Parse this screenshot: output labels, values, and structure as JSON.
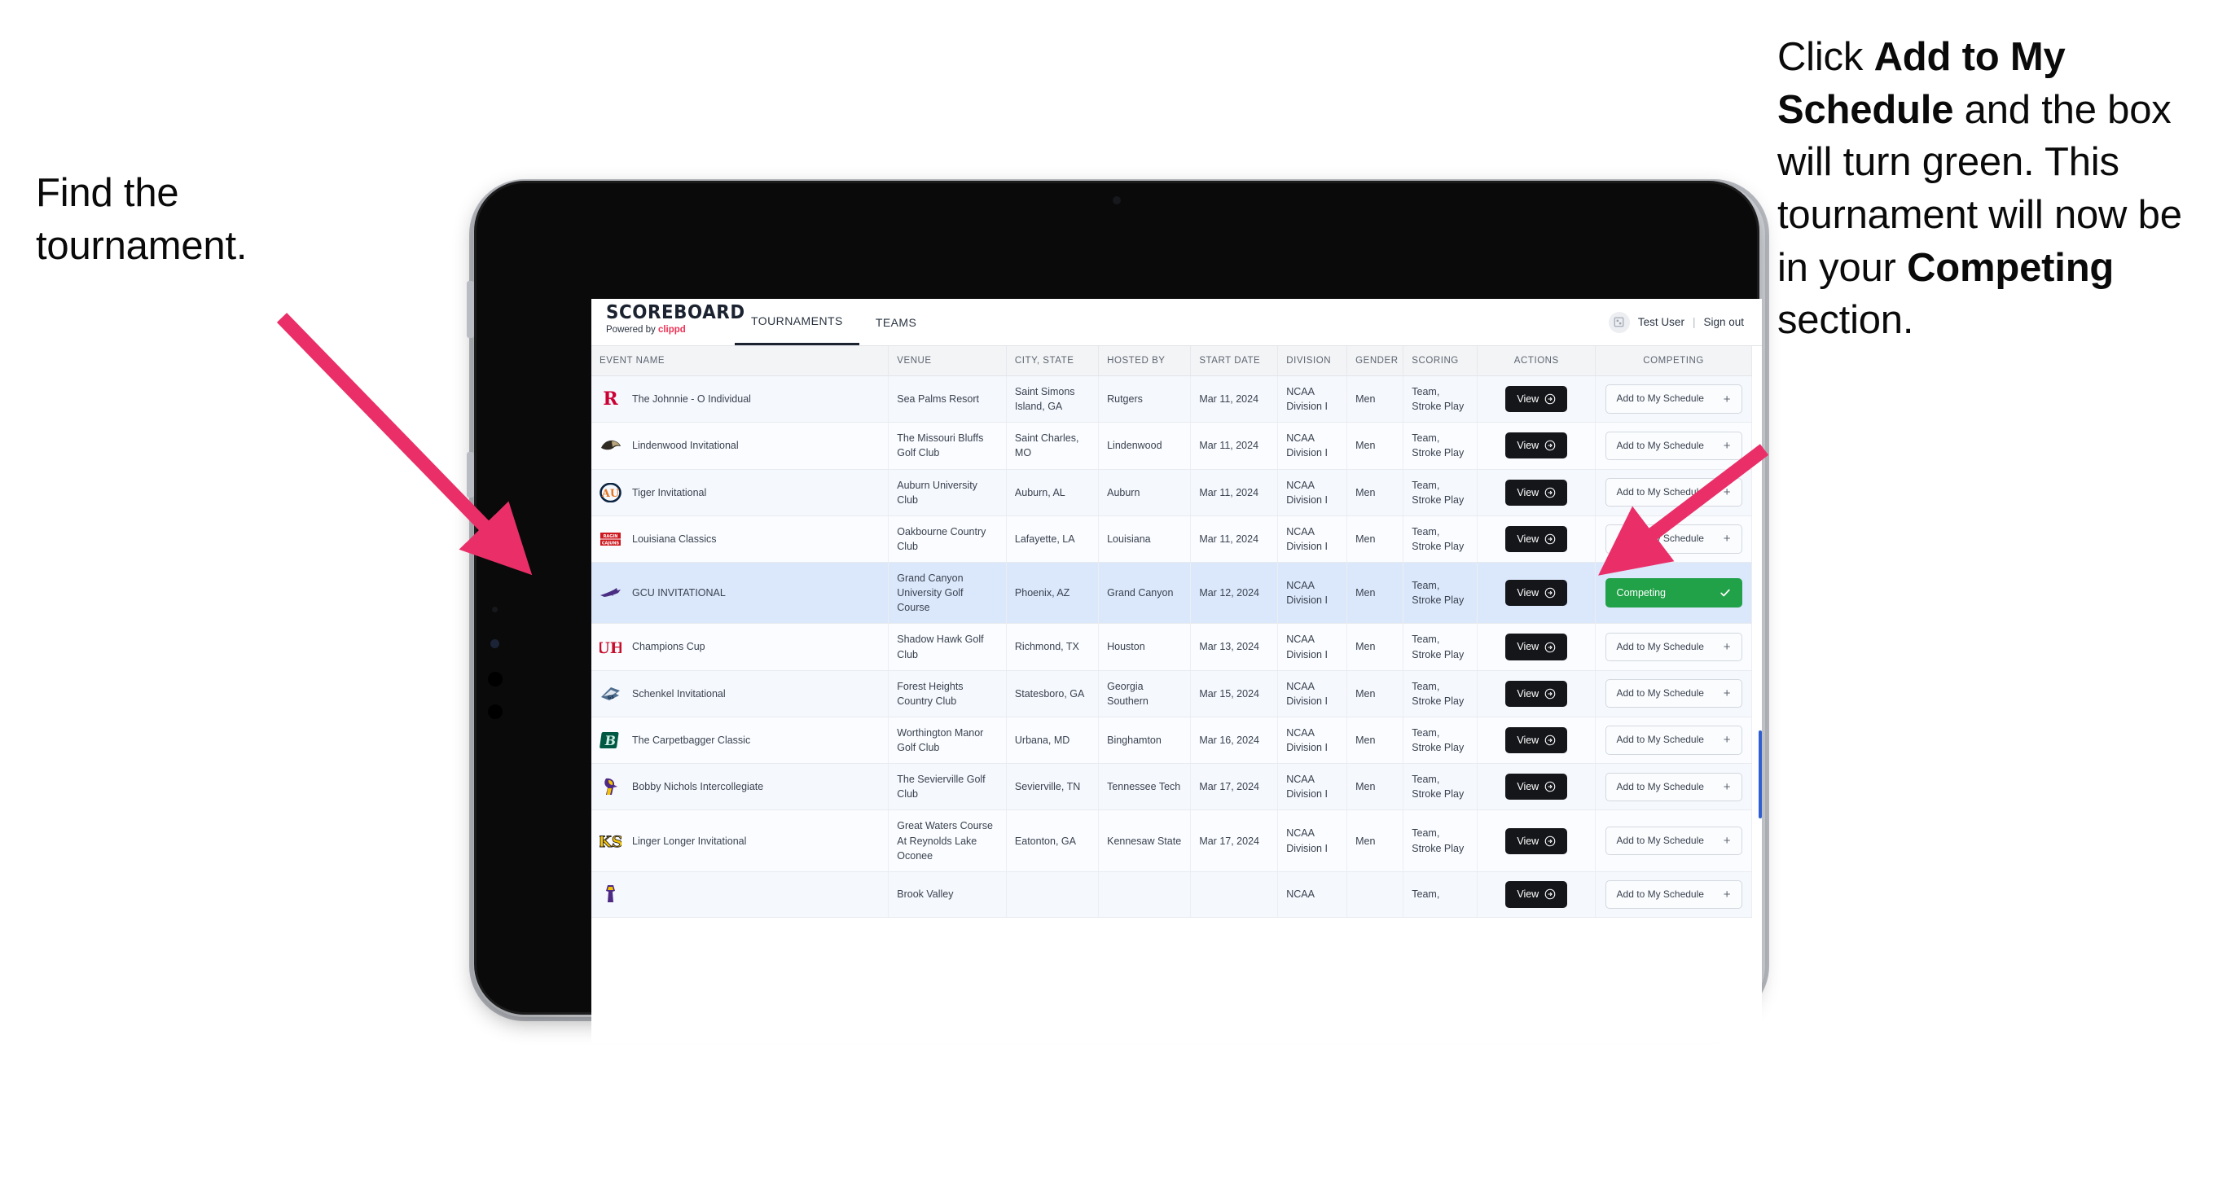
{
  "annotations": {
    "left": {
      "text": "Find the tournament."
    },
    "right": {
      "seg1": "Click ",
      "bold1": "Add to My Schedule",
      "seg2": " and the box will turn green. This tournament will now be in your ",
      "bold2": "Competing",
      "seg3": " section."
    },
    "arrow_color": "#ea2f68"
  },
  "app": {
    "brand": {
      "title": "SCOREBOARD",
      "powered_prefix": "Powered by ",
      "powered_brand": "clippd",
      "brand_accent": "#ef3054"
    },
    "nav": [
      {
        "label": "TOURNAMENTS",
        "active": true
      },
      {
        "label": "TEAMS",
        "active": false
      }
    ],
    "user": {
      "avatar_icon": "user-avatar-icon",
      "name": "Test User",
      "separator": "|",
      "sign_out": "Sign out"
    }
  },
  "table": {
    "columns": [
      "EVENT NAME",
      "VENUE",
      "CITY, STATE",
      "HOSTED BY",
      "START DATE",
      "DIVISION",
      "GENDER",
      "SCORING",
      "ACTIONS",
      "COMPETING"
    ],
    "action_label": "View",
    "add_label": "Add to My Schedule",
    "add_icon": "plus-icon",
    "competing_label": "Competing",
    "competing_icon": "check-icon",
    "competing_color": "#21a148",
    "rows": [
      {
        "logo": "rutgers-r-logo",
        "logo_color": "#cc0033",
        "event": "The Johnnie - O Individual",
        "venue": "Sea Palms Resort",
        "city": "Saint Simons Island, GA",
        "host": "Rutgers",
        "date": "Mar 11, 2024",
        "division": "NCAA Division I",
        "gender": "Men",
        "scoring": "Team, Stroke Play",
        "competing": false
      },
      {
        "logo": "lindenwood-lion-logo",
        "logo_color": "#2b2b2b",
        "event": "Lindenwood Invitational",
        "venue": "The Missouri Bluffs Golf Club",
        "city": "Saint Charles, MO",
        "host": "Lindenwood",
        "date": "Mar 11, 2024",
        "division": "NCAA Division I",
        "gender": "Men",
        "scoring": "Team, Stroke Play",
        "competing": false
      },
      {
        "logo": "auburn-au-logo",
        "logo_color": "#0c2340",
        "event": "Tiger Invitational",
        "venue": "Auburn University Club",
        "city": "Auburn, AL",
        "host": "Auburn",
        "date": "Mar 11, 2024",
        "division": "NCAA Division I",
        "gender": "Men",
        "scoring": "Team, Stroke Play",
        "competing": false
      },
      {
        "logo": "ragin-cajuns-logo",
        "logo_color": "#ce181e",
        "event": "Louisiana Classics",
        "venue": "Oakbourne Country Club",
        "city": "Lafayette, LA",
        "host": "Louisiana",
        "date": "Mar 11, 2024",
        "division": "NCAA Division I",
        "gender": "Men",
        "scoring": "Team, Stroke Play",
        "competing": false
      },
      {
        "logo": "gcu-lope-logo",
        "logo_color": "#4b2e83",
        "event": "GCU INVITATIONAL",
        "venue": "Grand Canyon University Golf Course",
        "city": "Phoenix, AZ",
        "host": "Grand Canyon",
        "date": "Mar 12, 2024",
        "division": "NCAA Division I",
        "gender": "Men",
        "scoring": "Team, Stroke Play",
        "competing": true
      },
      {
        "logo": "houston-uh-logo",
        "logo_color": "#c8102e",
        "event": "Champions Cup",
        "venue": "Shadow Hawk Golf Club",
        "city": "Richmond, TX",
        "host": "Houston",
        "date": "Mar 13, 2024",
        "division": "NCAA Division I",
        "gender": "Men",
        "scoring": "Team, Stroke Play",
        "competing": false
      },
      {
        "logo": "georgia-southern-eagle-logo",
        "logo_color": "#041e42",
        "event": "Schenkel Invitational",
        "venue": "Forest Heights Country Club",
        "city": "Statesboro, GA",
        "host": "Georgia Southern",
        "date": "Mar 15, 2024",
        "division": "NCAA Division I",
        "gender": "Men",
        "scoring": "Team, Stroke Play",
        "competing": false
      },
      {
        "logo": "binghamton-b-logo",
        "logo_color": "#005a43",
        "event": "The Carpetbagger Classic",
        "venue": "Worthington Manor Golf Club",
        "city": "Urbana, MD",
        "host": "Binghamton",
        "date": "Mar 16, 2024",
        "division": "NCAA Division I",
        "gender": "Men",
        "scoring": "Team, Stroke Play",
        "competing": false
      },
      {
        "logo": "tennessee-tech-eagle-logo",
        "logo_color": "#4e2a84",
        "event": "Bobby Nichols Intercollegiate",
        "venue": "The Sevierville Golf Club",
        "city": "Sevierville, TN",
        "host": "Tennessee Tech",
        "date": "Mar 17, 2024",
        "division": "NCAA Division I",
        "gender": "Men",
        "scoring": "Team, Stroke Play",
        "competing": false
      },
      {
        "logo": "kennesaw-state-ks-logo",
        "logo_color": "#f7c600",
        "event": "Linger Longer Invitational",
        "venue": "Great Waters Course At Reynolds Lake Oconee",
        "city": "Eatonton, GA",
        "host": "Kennesaw State",
        "date": "Mar 17, 2024",
        "division": "NCAA Division I",
        "gender": "Men",
        "scoring": "Team, Stroke Play",
        "competing": false
      },
      {
        "logo": "east-carolina-logo",
        "logo_color": "#4e2a84",
        "event": "",
        "venue": "Brook Valley",
        "city": "",
        "host": "",
        "date": "",
        "division": "NCAA",
        "gender": "",
        "scoring": "Team,",
        "competing": false,
        "clipped": true
      }
    ]
  }
}
